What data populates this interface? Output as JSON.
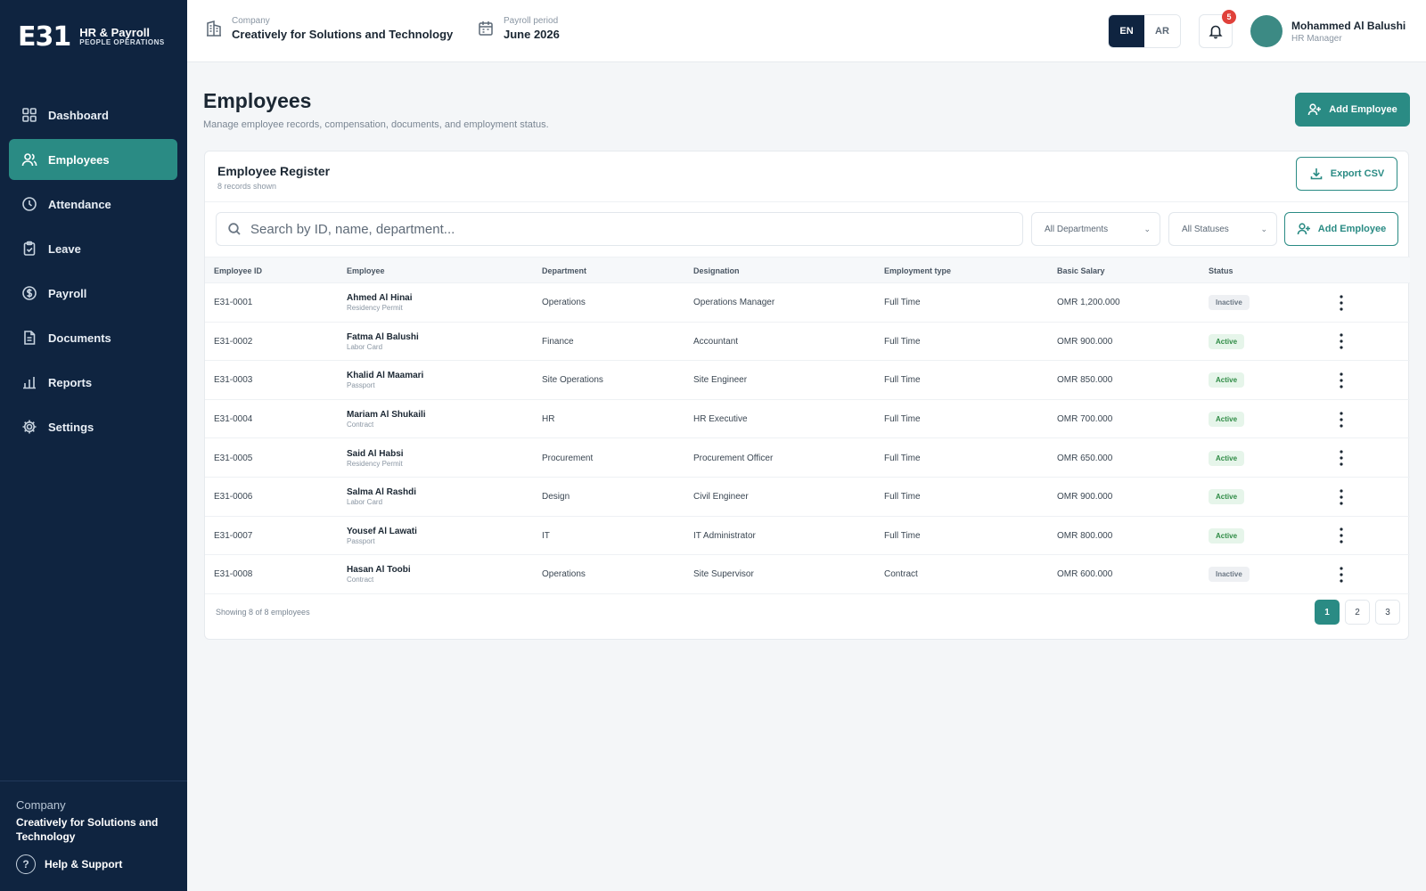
{
  "brand": {
    "logo": "E31",
    "title": "HR & Payroll",
    "subtitle": "PEOPLE OPERATIONS"
  },
  "sidebar": {
    "items": [
      {
        "label": "Dashboard",
        "icon": "grid-icon"
      },
      {
        "label": "Employees",
        "icon": "users-icon",
        "active": true
      },
      {
        "label": "Attendance",
        "icon": "clock-icon"
      },
      {
        "label": "Leave",
        "icon": "clipboard-icon"
      },
      {
        "label": "Payroll",
        "icon": "currency-icon"
      },
      {
        "label": "Documents",
        "icon": "document-icon"
      },
      {
        "label": "Reports",
        "icon": "bar-chart-icon"
      },
      {
        "label": "Settings",
        "icon": "gear-icon"
      }
    ],
    "company_label": "Company",
    "company_name": "Creatively for Solutions and Technology",
    "help_label": "Help & Support"
  },
  "topbar": {
    "company_label": "Company",
    "company_value": "Creatively for Solutions and Technology",
    "period_label": "Payroll period",
    "period_value": "June 2026",
    "lang_en": "EN",
    "lang_ar": "AR",
    "notification_count": "5",
    "user_name": "Mohammed Al Balushi",
    "user_role": "HR Manager"
  },
  "page": {
    "title": "Employees",
    "subtitle": "Manage employee records, compensation, documents, and employment status.",
    "add_button": "Add Employee"
  },
  "register": {
    "title": "Employee Register",
    "count_text": "8 records shown",
    "export_button": "Export CSV",
    "search_placeholder": "Search by ID, name, department...",
    "department_filter": "All Departments",
    "status_filter": "All Statuses",
    "add_button": "Add Employee",
    "columns": [
      "Employee ID",
      "Employee",
      "Department",
      "Designation",
      "Employment type",
      "Basic Salary",
      "Status"
    ],
    "rows": [
      {
        "id": "E31-0001",
        "name": "Ahmed Al Hinai",
        "doc": "Residency Permit",
        "department": "Operations",
        "designation": "Operations Manager",
        "type": "Full Time",
        "salary": "OMR 1,200.000",
        "status": "Inactive",
        "status_key": "inactive"
      },
      {
        "id": "E31-0002",
        "name": "Fatma Al Balushi",
        "doc": "Labor Card",
        "department": "Finance",
        "designation": "Accountant",
        "type": "Full Time",
        "salary": "OMR 900.000",
        "status": "Active",
        "status_key": "active"
      },
      {
        "id": "E31-0003",
        "name": "Khalid Al Maamari",
        "doc": "Passport",
        "department": "Site Operations",
        "designation": "Site Engineer",
        "type": "Full Time",
        "salary": "OMR 850.000",
        "status": "Active",
        "status_key": "active"
      },
      {
        "id": "E31-0004",
        "name": "Mariam Al Shukaili",
        "doc": "Contract",
        "department": "HR",
        "designation": "HR Executive",
        "type": "Full Time",
        "salary": "OMR 700.000",
        "status": "Active",
        "status_key": "active"
      },
      {
        "id": "E31-0005",
        "name": "Said Al Habsi",
        "doc": "Residency Permit",
        "department": "Procurement",
        "designation": "Procurement Officer",
        "type": "Full Time",
        "salary": "OMR 650.000",
        "status": "Active",
        "status_key": "active"
      },
      {
        "id": "E31-0006",
        "name": "Salma Al Rashdi",
        "doc": "Labor Card",
        "department": "Design",
        "designation": "Civil Engineer",
        "type": "Full Time",
        "salary": "OMR 900.000",
        "status": "Active",
        "status_key": "active"
      },
      {
        "id": "E31-0007",
        "name": "Yousef Al Lawati",
        "doc": "Passport",
        "department": "IT",
        "designation": "IT Administrator",
        "type": "Full Time",
        "salary": "OMR 800.000",
        "status": "Active",
        "status_key": "active"
      },
      {
        "id": "E31-0008",
        "name": "Hasan Al Toobi",
        "doc": "Contract",
        "department": "Operations",
        "designation": "Site Supervisor",
        "type": "Contract",
        "salary": "OMR 600.000",
        "status": "Inactive",
        "status_key": "inactive"
      }
    ],
    "footer_text": "Showing 8 of 8 employees",
    "pages": [
      "1",
      "2",
      "3"
    ]
  },
  "colors": {
    "sidebar": "#0f2440",
    "accent": "#2a8b84",
    "active_badge": "#2f8b45",
    "notification": "#e0413a"
  }
}
